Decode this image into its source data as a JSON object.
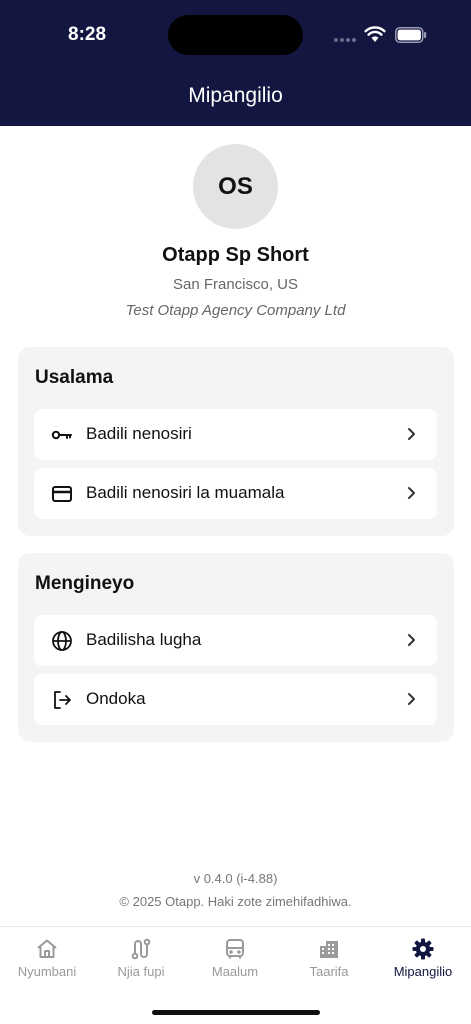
{
  "status_bar": {
    "time": "8:28"
  },
  "header": {
    "title": "Mipangilio"
  },
  "profile": {
    "initials": "OS",
    "name": "Otapp Sp Short",
    "location": "San Francisco, US",
    "company": "Test Otapp Agency Company Ltd"
  },
  "sections": [
    {
      "title": "Usalama",
      "items": [
        {
          "label": "Badili nenosiri",
          "icon": "key-icon"
        },
        {
          "label": "Badili nenosiri la muamala",
          "icon": "credit-card-icon"
        }
      ]
    },
    {
      "title": "Mengineyo",
      "items": [
        {
          "label": "Badilisha lugha",
          "icon": "globe-icon"
        },
        {
          "label": "Ondoka",
          "icon": "logout-icon"
        }
      ]
    }
  ],
  "footer": {
    "version": "v 0.4.0 (i-4.88)",
    "copyright": "© 2025 Otapp. Haki zote zimehifadhiwa."
  },
  "tabs": [
    {
      "label": "Nyumbani",
      "icon": "home-icon"
    },
    {
      "label": "Njia fupi",
      "icon": "route-icon"
    },
    {
      "label": "Maalum",
      "icon": "bus-icon"
    },
    {
      "label": "Taarifa",
      "icon": "buildings-icon"
    },
    {
      "label": "Mipangilio",
      "icon": "gear-icon",
      "active": true
    }
  ],
  "colors": {
    "header_bg": "#131640",
    "active_tab": "#131640",
    "inactive_tab": "#9a9a9a",
    "section_bg": "#f4f4f4"
  }
}
